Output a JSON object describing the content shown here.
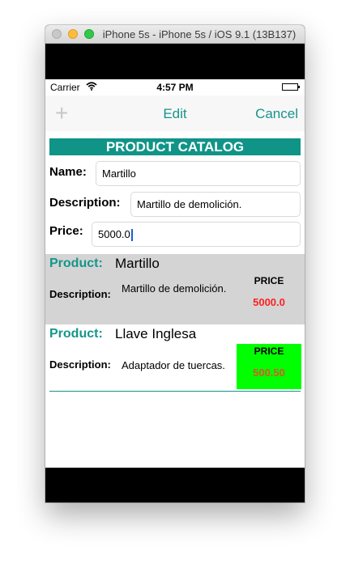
{
  "window": {
    "title": "iPhone 5s - iPhone 5s / iOS 9.1 (13B137)"
  },
  "status_bar": {
    "carrier": "Carrier",
    "wifi_icon": "wifi-icon",
    "time": "4:57 PM",
    "battery_icon": "battery-icon"
  },
  "nav": {
    "add_icon": "+",
    "edit_label": "Edit",
    "cancel_label": "Cancel"
  },
  "catalog": {
    "title": "PRODUCT CATALOG",
    "form": {
      "name_label": "Name:",
      "name_value": "Martillo",
      "description_label": "Description:",
      "description_value": "Martillo de demolición.",
      "price_label": "Price:",
      "price_value": "5000.0"
    },
    "products": [
      {
        "product_label": "Product:",
        "name": "Martillo",
        "description_label": "Description:",
        "description": "Martillo de demolición.",
        "price_header": "PRICE",
        "price": "5000.0",
        "price_color": "#ff2020",
        "price_bg": "#d4d4d4"
      },
      {
        "product_label": "Product:",
        "name": "Llave Inglesa",
        "description_label": "Description:",
        "description": "Adaptador de tuercas.",
        "price_header": "PRICE",
        "price": "500.50",
        "price_color": "#d85a28",
        "price_bg": "#00ff00"
      }
    ]
  },
  "colors": {
    "accent": "#109488",
    "nav_text": "#14968a"
  }
}
